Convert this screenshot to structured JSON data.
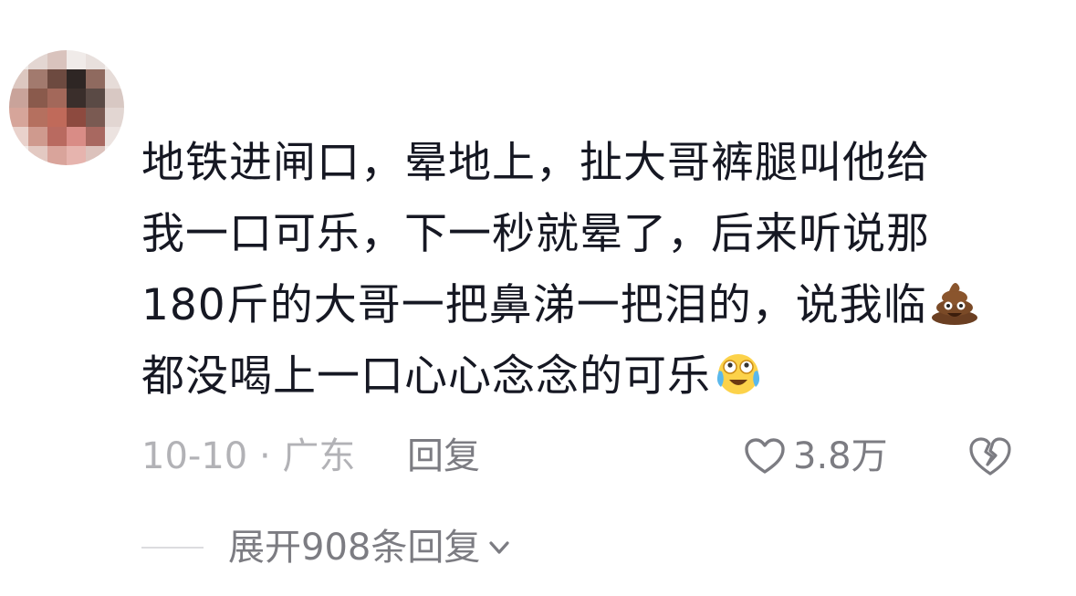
{
  "comment": {
    "text_lines": [
      "地铁进闸口，晕地上，扯大哥裤腿叫他给",
      "我一口可乐，下一秒就晕了，后来听说那",
      "180斤的大哥一把鼻涕一把泪的，说我临",
      "都没喝上一口心心念念的可乐"
    ],
    "emoji_1": "poop-emoji",
    "emoji_2": "laughing-crying-emoji",
    "date": "10-10",
    "separator": "·",
    "location": "广东",
    "reply_label": "回复",
    "like_count": "3.8万"
  },
  "replies": {
    "expand_label": "展开908条回复"
  },
  "colors": {
    "text_primary": "#161823",
    "text_secondary": "#7c7c82",
    "text_tertiary": "#b2b2b6"
  }
}
